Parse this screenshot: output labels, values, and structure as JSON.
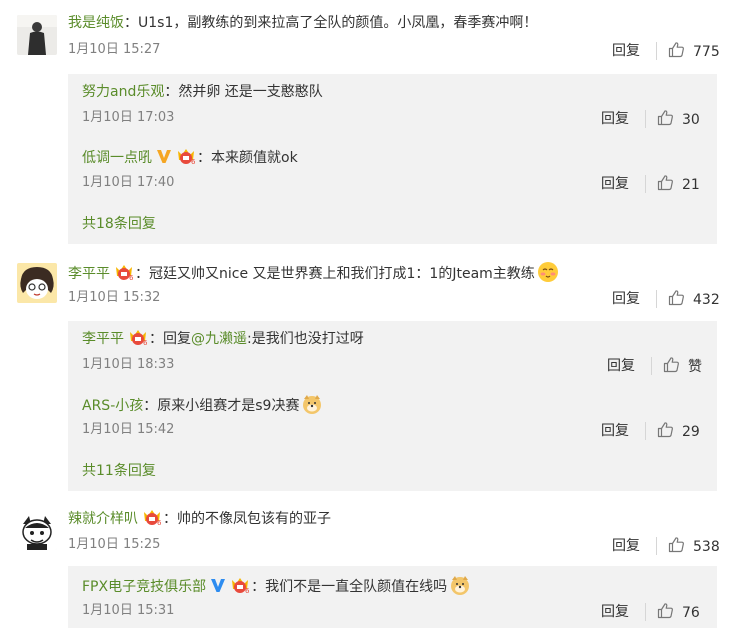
{
  "comments": [
    {
      "user": "我是纯饭",
      "text": "U1s1，副教练的到来拉高了全队的颜值。小凤凰，春季赛冲啊！",
      "date": "1月10日 15:27",
      "reply_label": "回复",
      "likes": "775",
      "replies": [
        {
          "user": "努力and乐观",
          "text": "然并卵 还是一支憨憨队",
          "date": "1月10日 17:03",
          "reply_label": "回复",
          "likes": "30"
        },
        {
          "user": "低调一点吼",
          "text": "本来颜值就ok",
          "date": "1月10日 17:40",
          "reply_label": "回复",
          "likes": "21"
        }
      ],
      "more": "共18条回复"
    },
    {
      "user": "李平平",
      "text": "冠廷又帅又nice 又是世界赛上和我们打成1：1的Jteam主教练",
      "date": "1月10日 15:32",
      "reply_label": "回复",
      "likes": "432",
      "replies": [
        {
          "user": "李平平",
          "reply_word": "回复",
          "mention": "@九濑遥",
          "text": "是我们也没打过呀",
          "date": "1月10日 18:33",
          "reply_label": "回复",
          "likes": "赞"
        },
        {
          "user": "ARS-小孩",
          "text": "原来小组赛才是s9决赛",
          "date": "1月10日 15:42",
          "reply_label": "回复",
          "likes": "29"
        }
      ],
      "more": "共11条回复"
    },
    {
      "user": "辣就介样叭",
      "text": "帅的不像凤包该有的亚子",
      "date": "1月10日 15:25",
      "reply_label": "回复",
      "likes": "538",
      "replies": [
        {
          "user": "FPX电子竞技俱乐部",
          "text": "我们不是一直全队颜值在线吗",
          "date": "1月10日 15:31",
          "reply_label": "回复",
          "likes": "76"
        }
      ]
    }
  ],
  "colors": {
    "username": "#5a8c2a",
    "reply_bg": "#f2f2f2",
    "meta": "#808080",
    "verified": "#f5a623",
    "verified_blue": "#2d8cf0"
  }
}
